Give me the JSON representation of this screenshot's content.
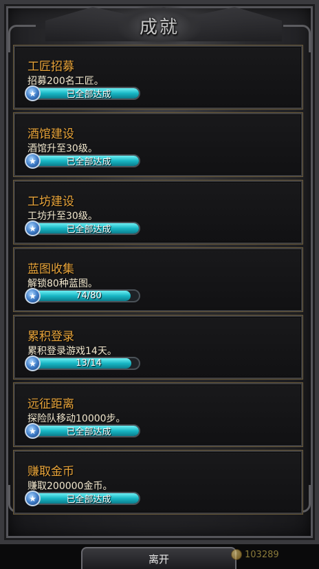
{
  "window": {
    "title": "成就"
  },
  "achievements": [
    {
      "title": "工匠招募",
      "desc": "招募200名工匠。",
      "status": "已全部达成",
      "progress": 1.0
    },
    {
      "title": "酒馆建设",
      "desc": "酒馆升至30级。",
      "status": "已全部达成",
      "progress": 1.0
    },
    {
      "title": "工坊建设",
      "desc": "工坊升至30级。",
      "status": "已全部达成",
      "progress": 1.0
    },
    {
      "title": "蓝图收集",
      "desc": "解锁80种蓝图。",
      "status": "74/80",
      "progress": 0.925
    },
    {
      "title": "累积登录",
      "desc": "累积登录游戏14天。",
      "status": "13/14",
      "progress": 0.9286
    },
    {
      "title": "远征距离",
      "desc": "探险队移动10000步。",
      "status": "已全部达成",
      "progress": 1.0
    },
    {
      "title": "赚取金币",
      "desc": "赚取200000金币。",
      "status": "已全部达成",
      "progress": 1.0
    }
  ],
  "footer": {
    "leave_label": "离开",
    "gold_amount": "103289"
  },
  "icons": {
    "badge": "star-icon",
    "coin": "coin-icon"
  },
  "colors": {
    "title": "#e8a43a",
    "desc": "#f0e6cc",
    "bar": "#18b6c4"
  }
}
